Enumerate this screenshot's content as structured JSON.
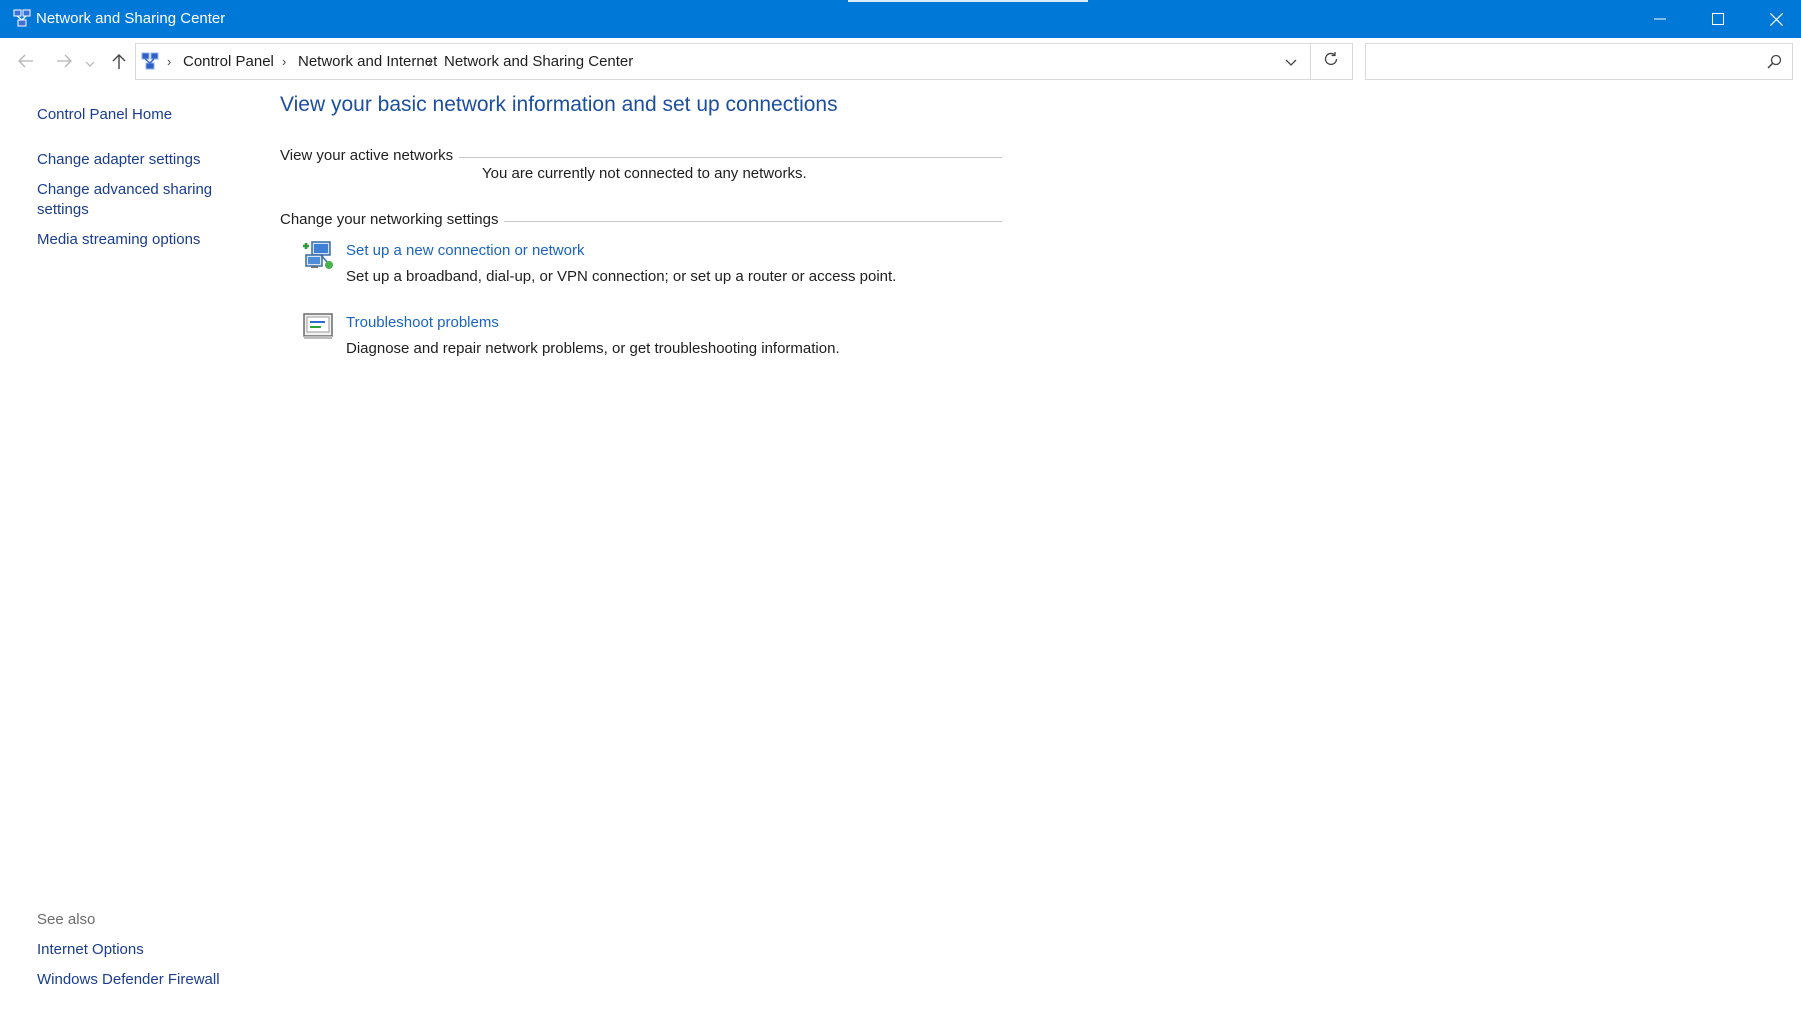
{
  "window": {
    "title": "Network and Sharing Center",
    "accent_color": "#0078d7",
    "controls": {
      "minimize_icon": "minimize-icon",
      "maximize_icon": "maximize-icon",
      "close_icon": "close-icon"
    }
  },
  "navigation": {
    "breadcrumb": [
      "Control Panel",
      "Network and Internet",
      "Network and Sharing Center"
    ],
    "search_value": "",
    "icons": [
      "back-arrow-icon",
      "forward-arrow-icon",
      "recent-locations-icon",
      "up-arrow-icon",
      "refresh-icon",
      "search-icon"
    ]
  },
  "sidebar": {
    "home": "Control Panel Home",
    "links": [
      "Change adapter settings",
      "Change advanced sharing settings",
      "Media streaming options"
    ],
    "see_also_label": "See also",
    "see_also_links": [
      "Internet Options",
      "Windows Defender Firewall"
    ]
  },
  "main": {
    "title": "View your basic network information and set up connections",
    "active_networks": {
      "label": "View your active networks",
      "status": "You are currently not connected to any networks."
    },
    "settings": {
      "label": "Change your networking settings",
      "tasks": [
        {
          "link": "Set up a new connection or network",
          "description": "Set up a broadband, dial-up, or VPN connection; or set up a router or access point.",
          "icon": "new-connection-icon"
        },
        {
          "link": "Troubleshoot problems",
          "description": "Diagnose and repair network problems, or get troubleshooting information.",
          "icon": "troubleshoot-icon"
        }
      ]
    }
  },
  "colors": {
    "link": "#1a64c0",
    "heading": "#1d4fa0",
    "sidebar_link": "#1a3d8f"
  }
}
